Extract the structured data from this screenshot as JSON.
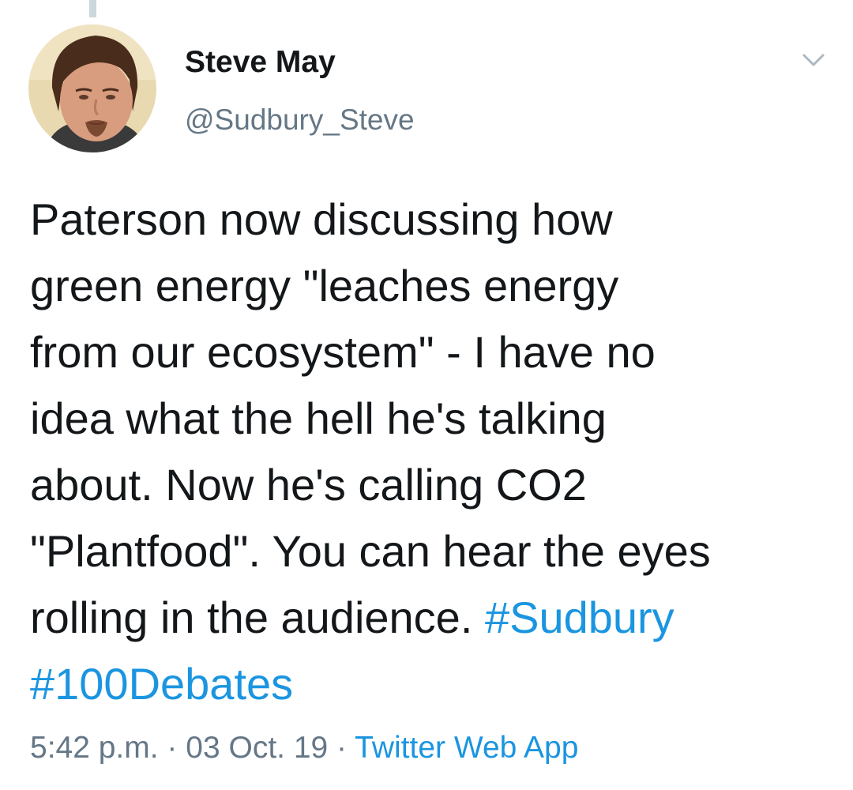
{
  "author": {
    "display_name": "Steve May",
    "handle": "@Sudbury_Steve"
  },
  "icons": {
    "caret": "chevron-down-icon",
    "avatar": "profile-photo"
  },
  "tweet": {
    "lines": [
      "Paterson now discussing how",
      "green energy \"leaches energy",
      "from our ecosystem\" - I have no",
      "idea what the hell he's talking",
      "about. Now he's calling CO2",
      "\"Plantfood\". You can hear the eyes",
      "rolling in the audience. "
    ],
    "hashtags": [
      "#Sudbury",
      "#100Debates"
    ]
  },
  "meta": {
    "time": "5:42 p.m.",
    "separator": " · ",
    "date": "03 Oct. 19",
    "source": "Twitter Web App"
  },
  "colors": {
    "text": "#14171a",
    "secondary": "#657786",
    "link": "#1b95e0"
  }
}
